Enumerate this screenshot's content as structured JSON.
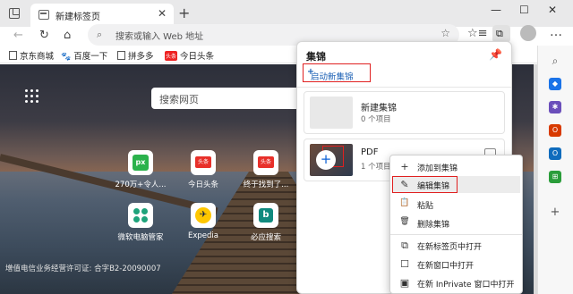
{
  "tab": {
    "title": "新建标签页",
    "close": "✕",
    "new_tab": "+"
  },
  "window_controls": {
    "minimize": "—",
    "maximize": "☐",
    "close": "✕"
  },
  "toolbar": {
    "back": "←",
    "reload": "↻",
    "home": "⌂",
    "address_placeholder": "搜索或输入 Web 地址",
    "search_glyph": "⌕",
    "favorite_glyph": "☆",
    "favorites_glyph": "☆≡",
    "collections_glyph": "⧉",
    "more_glyph": "…"
  },
  "favorites": [
    {
      "label": "京东商城",
      "icon": "document-icon"
    },
    {
      "label": "百度一下",
      "icon": "baidu-paw-icon",
      "glyph": "🐾"
    },
    {
      "label": "拼多多",
      "icon": "document-icon"
    },
    {
      "label": "今日头条",
      "icon": "toutiao-icon",
      "badge": "头条"
    }
  ],
  "ntp": {
    "search_placeholder": "搜索网页",
    "tiles": [
      {
        "label": "270万+令人...",
        "icon": "px-icon",
        "glyph": "px"
      },
      {
        "label": "今日头条",
        "icon": "toutiao-icon",
        "glyph": "头条"
      },
      {
        "label": "终于找到了...",
        "icon": "toutiao-icon",
        "glyph": "头条"
      },
      {
        "label": "微软电脑管家",
        "icon": "ms-pc-manager-icon"
      },
      {
        "label": "Expedia",
        "icon": "expedia-icon",
        "glyph": "✈"
      },
      {
        "label": "必应搜索",
        "icon": "bing-icon",
        "glyph": "b"
      }
    ],
    "icp_text": "增值电信业务经营许可证: 合字B2-20090007"
  },
  "collections": {
    "title": "集锦",
    "pin_glyph": "📌",
    "start_new": "启动新集锦",
    "start_glyph": "+",
    "items": [
      {
        "name": "新建集锦",
        "count": "0 个项目"
      },
      {
        "name": "PDF",
        "count": "1 个项目",
        "edit_glyph": "+"
      }
    ]
  },
  "context_menu": {
    "items": [
      {
        "label": "添加到集锦",
        "icon": "plus-icon",
        "glyph": "+"
      },
      {
        "label": "编辑集锦",
        "icon": "pencil-icon",
        "glyph": "✎"
      },
      {
        "label": "粘贴",
        "icon": "clipboard-icon",
        "glyph": "📋"
      },
      {
        "label": "删除集锦",
        "icon": "trash-icon",
        "glyph": "🗑"
      },
      {
        "label": "在新标签页中打开",
        "icon": "new-tab-icon",
        "glyph": "⧉"
      },
      {
        "label": "在新窗口中打开",
        "icon": "new-window-icon",
        "glyph": "☐"
      },
      {
        "label": "在新 InPrivate 窗口中打开",
        "icon": "inprivate-icon",
        "glyph": "▣"
      }
    ]
  },
  "sidebar": {
    "items": [
      {
        "icon": "search-icon",
        "glyph": "⌕",
        "color": "#555555"
      },
      {
        "icon": "shopping-tag-icon",
        "glyph": "◆",
        "color": "#1a73e8"
      },
      {
        "icon": "tools-icon",
        "glyph": "✱",
        "color": "#6b4fbb"
      },
      {
        "icon": "office-icon",
        "glyph": "O",
        "color": "#d83b01"
      },
      {
        "icon": "outlook-icon",
        "glyph": "O",
        "color": "#0f6cbd"
      },
      {
        "icon": "windows-icon",
        "glyph": "⊞",
        "color": "#2a9d3a"
      },
      {
        "icon": "add-icon",
        "glyph": "+",
        "color": "#555555"
      }
    ]
  },
  "colors": {
    "accent_red": "#e02020",
    "link_blue": "#1a5fb4"
  }
}
